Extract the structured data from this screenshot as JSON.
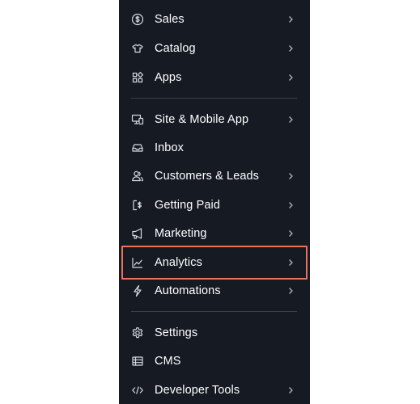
{
  "sidebar": {
    "items": [
      {
        "label": "Sales",
        "icon": "dollar-circle-icon",
        "has_submenu": true
      },
      {
        "label": "Catalog",
        "icon": "catalog-icon",
        "has_submenu": true
      },
      {
        "label": "Apps",
        "icon": "apps-icon",
        "has_submenu": true
      },
      {
        "label": "Site & Mobile App",
        "icon": "devices-icon",
        "has_submenu": true
      },
      {
        "label": "Inbox",
        "icon": "inbox-icon",
        "has_submenu": false
      },
      {
        "label": "Customers & Leads",
        "icon": "customers-icon",
        "has_submenu": true
      },
      {
        "label": "Getting Paid",
        "icon": "getting-paid-icon",
        "has_submenu": true
      },
      {
        "label": "Marketing",
        "icon": "megaphone-icon",
        "has_submenu": true
      },
      {
        "label": "Analytics",
        "icon": "line-chart-icon",
        "has_submenu": true,
        "highlighted": true
      },
      {
        "label": "Automations",
        "icon": "lightning-icon",
        "has_submenu": true
      },
      {
        "label": "Settings",
        "icon": "gear-icon",
        "has_submenu": false
      },
      {
        "label": "CMS",
        "icon": "database-icon",
        "has_submenu": false
      },
      {
        "label": "Developer Tools",
        "icon": "code-icon",
        "has_submenu": true
      }
    ]
  },
  "colors": {
    "sidebar_bg": "#151a23",
    "text": "#ffffff",
    "icon": "#d7dae0",
    "chevron": "#aeb3bc",
    "divider": "#3a3f49",
    "highlight_border": "#e8735a",
    "page_bg": "#ffffff"
  }
}
